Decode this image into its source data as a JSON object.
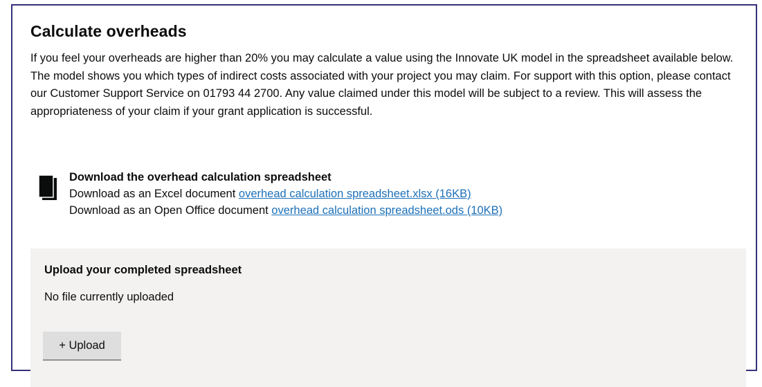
{
  "section": {
    "title": "Calculate overheads",
    "intro": "If you feel your overheads are higher than 20% you may calculate a value using the Innovate UK model in the spreadsheet available below. The model shows you which types of indirect costs associated with your project you may claim. For support with this option, please contact our Customer Support Service on 01793 44 2700. Any value claimed under this model will be subject to a review. This will assess the appropriateness of your claim if your grant application is successful."
  },
  "download": {
    "icon": "document-icon",
    "title": "Download the overhead calculation spreadsheet",
    "excel_prefix": "Download as an Excel document ",
    "excel_link": "overhead calculation spreadsheet.xlsx (16KB)",
    "ods_prefix": "Download as an Open Office document ",
    "ods_link": "overhead calculation spreadsheet.ods (10KB)"
  },
  "upload": {
    "title": "Upload your completed spreadsheet",
    "status": "No file currently uploaded",
    "button_label": "+ Upload"
  },
  "colors": {
    "link": "#1d70b8",
    "border": "#35307a",
    "panel": "#f3f2f1",
    "button": "#dedede"
  }
}
